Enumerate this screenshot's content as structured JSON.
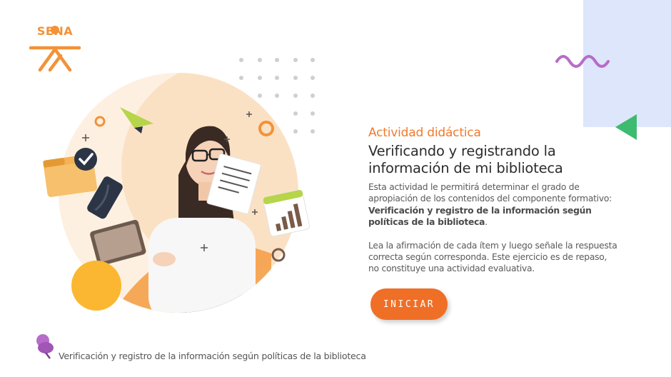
{
  "brand": {
    "logo_text": "SENA",
    "color": "#f39237"
  },
  "activity": {
    "kicker": "Actividad didáctica",
    "title": "Verificando y registrando la información de mi biblioteca",
    "intro": "Esta actividad le permitirá determinar el grado de apropiación de los contenidos del componente formativo:",
    "intro_bold": "Verificación y registro de la información según políticas de la biblioteca",
    "intro_end": ".",
    "instructions": "Lea la afirmación de cada ítem y luego señale la respuesta correcta según corresponda.  Este ejercicio es de repaso, no constituye una actividad evaluativa."
  },
  "start_button": {
    "label": "INICIAR",
    "color": "#ef6f27"
  },
  "footer": {
    "text": "Verificación y registro de la información según políticas de la biblioteca"
  },
  "icons": [
    "sena-logo",
    "pin-icon",
    "check-icon",
    "folder-icon",
    "paper-plane-icon",
    "document-icon",
    "chart-icon",
    "tablet-icon"
  ],
  "colors": {
    "panel_blue": "#dde6fb",
    "accent_orange": "#f07a2c",
    "squiggle_purple": "#b86cc9",
    "triangle_green": "#3dbb6e",
    "circle_yellow": "#fbb731"
  }
}
